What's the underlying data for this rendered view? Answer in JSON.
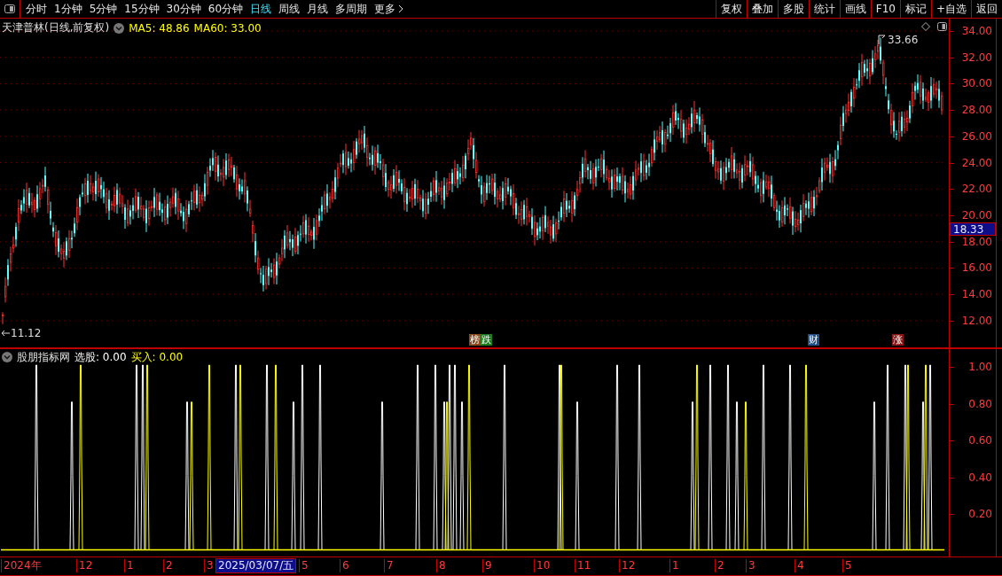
{
  "toolbar": {
    "periods": [
      {
        "label": "分时",
        "selected": false
      },
      {
        "label": "1分钟",
        "selected": false
      },
      {
        "label": "5分钟",
        "selected": false
      },
      {
        "label": "15分钟",
        "selected": false
      },
      {
        "label": "30分钟",
        "selected": false
      },
      {
        "label": "60分钟",
        "selected": false
      },
      {
        "label": "日线",
        "selected": true
      },
      {
        "label": "周线",
        "selected": false
      },
      {
        "label": "月线",
        "selected": false
      },
      {
        "label": "多周期",
        "selected": false
      }
    ],
    "more": "更多",
    "buttons": [
      "复权",
      "叠加",
      "多股",
      "统计",
      "画线",
      "F10",
      "标记",
      "+自选",
      "返回"
    ]
  },
  "chart": {
    "title": "天津普林(日线,前复权)",
    "ma": [
      "MA5: 48.86",
      "MA60: 33.00"
    ],
    "high_label": "33.66",
    "low_label": "11.12",
    "price_axis": [
      "34.00",
      "32.00",
      "30.00",
      "28.00",
      "26.00",
      "24.00",
      "22.00",
      "20.00",
      "18.00",
      "16.00",
      "14.00",
      "12.00"
    ],
    "current_price": "18.33",
    "events": [
      {
        "label": "榜",
        "color": "#8b4a1c"
      },
      {
        "label": "跌",
        "color": "#1d7a1d"
      },
      {
        "label": "财",
        "color": "#1f4f86"
      },
      {
        "label": "涨",
        "color": "#8a1414"
      }
    ]
  },
  "indicator": {
    "title": "股朋指标网",
    "values": [
      {
        "label": "选股: 0.00",
        "color": "#ffffff"
      },
      {
        "label": "买入: 0.00",
        "color": "#ffff00"
      }
    ],
    "axis": [
      "1.00",
      "0.80",
      "0.60",
      "0.40",
      "0.20"
    ]
  },
  "date_axis": {
    "labels": [
      {
        "label": "2024年",
        "selected": false
      },
      {
        "label": "12",
        "selected": false
      },
      {
        "label": "1",
        "selected": false
      },
      {
        "label": "2",
        "selected": false
      },
      {
        "label": "3",
        "selected": false
      },
      {
        "label": "2025/03/07/五",
        "selected": true
      },
      {
        "label": "5",
        "selected": false
      },
      {
        "label": "6",
        "selected": false
      },
      {
        "label": "7",
        "selected": false
      },
      {
        "label": "8",
        "selected": false
      },
      {
        "label": "9",
        "selected": false
      },
      {
        "label": "10",
        "selected": false
      },
      {
        "label": "11",
        "selected": false
      },
      {
        "label": "12",
        "selected": false
      },
      {
        "label": "1",
        "selected": false
      },
      {
        "label": "2",
        "selected": false
      },
      {
        "label": "3",
        "selected": false
      },
      {
        "label": "4",
        "selected": false
      },
      {
        "label": "5",
        "selected": false
      }
    ]
  }
}
